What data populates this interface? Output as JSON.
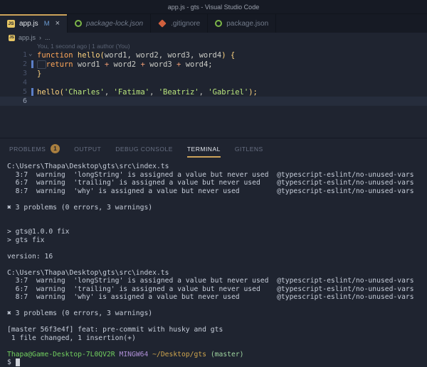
{
  "window": {
    "title": "app.js - gts - Visual Studio Code"
  },
  "colors": {
    "background": "#1f2430",
    "chrome": "#161a24",
    "accent_gold": "#cda35a",
    "keyword": "#ffa759",
    "function": "#ffd580",
    "string": "#bae67e",
    "git_modified_bar": "#5b7fc7",
    "prompt_user_green": "#72cf5f",
    "prompt_shell_magenta": "#ae8fd6",
    "prompt_path_gold": "#cea54e",
    "prompt_branch_green": "#9fd6a0"
  },
  "tabs": [
    {
      "label": "app.js",
      "icon": "js",
      "active": true,
      "modified": "M",
      "close": "×"
    },
    {
      "label": "package-lock.json",
      "icon": "npm",
      "italic": true
    },
    {
      "label": ".gitignore",
      "icon": "git"
    },
    {
      "label": "package.json",
      "icon": "npm"
    }
  ],
  "breadcrumb": {
    "file": "app.js",
    "separator": "›",
    "more": "..."
  },
  "editor": {
    "codelens": "You, 1 second ago | 1 author (You)",
    "lines": [
      {
        "num": "1",
        "fold": "⌄",
        "tokens": [
          {
            "t": "function ",
            "c": "keyword"
          },
          {
            "t": "hello",
            "c": "func"
          },
          {
            "t": "(",
            "c": "brace"
          },
          {
            "t": "word1, word2, word3, word4",
            "c": "fg"
          },
          {
            "t": ") {",
            "c": "brace"
          }
        ]
      },
      {
        "num": "2",
        "modified": true,
        "tokens": [
          {
            "t": "  ",
            "c": "fg",
            "box": true
          },
          {
            "t": "return",
            "c": "keyword"
          },
          {
            "t": " word1 ",
            "c": "fg"
          },
          {
            "t": "+",
            "c": "op"
          },
          {
            "t": " word2 ",
            "c": "fg"
          },
          {
            "t": "+",
            "c": "op"
          },
          {
            "t": " word3 ",
            "c": "fg"
          },
          {
            "t": "+",
            "c": "op"
          },
          {
            "t": " word4;",
            "c": "fg"
          }
        ]
      },
      {
        "num": "3",
        "tokens": [
          {
            "t": "}",
            "c": "brace"
          }
        ]
      },
      {
        "num": "4",
        "tokens": []
      },
      {
        "num": "5",
        "modified": true,
        "tokens": [
          {
            "t": "hello",
            "c": "func"
          },
          {
            "t": "(",
            "c": "brace"
          },
          {
            "t": "'Charles'",
            "c": "string"
          },
          {
            "t": ", ",
            "c": "fg"
          },
          {
            "t": "'Fatima'",
            "c": "string"
          },
          {
            "t": ", ",
            "c": "fg"
          },
          {
            "t": "'Beatriz'",
            "c": "string"
          },
          {
            "t": ", ",
            "c": "fg"
          },
          {
            "t": "'Gabriel'",
            "c": "string"
          },
          {
            "t": ");",
            "c": "brace"
          }
        ]
      },
      {
        "num": "6",
        "current": true,
        "tokens": []
      }
    ]
  },
  "panel": {
    "tabs": [
      {
        "label": "PROBLEMS",
        "badge": "1"
      },
      {
        "label": "OUTPUT"
      },
      {
        "label": "DEBUG CONSOLE"
      },
      {
        "label": "TERMINAL",
        "active": true
      },
      {
        "label": "GITLENS"
      }
    ]
  },
  "terminal": {
    "lines": [
      [
        {
          "t": "C:\\Users\\Thapa\\Desktop\\gts\\src\\index.ts"
        }
      ],
      [
        {
          "t": "  3:7  warning  'longString' is assigned a value but never used  @typescript-eslint/no-unused-vars"
        }
      ],
      [
        {
          "t": "  6:7  warning  'trailing' is assigned a value but never used    @typescript-eslint/no-unused-vars"
        }
      ],
      [
        {
          "t": "  8:7  warning  'why' is assigned a value but never used         @typescript-eslint/no-unused-vars"
        }
      ],
      [],
      [
        {
          "t": "✖ 3 problems (0 errors, 3 warnings)"
        }
      ],
      [],
      [],
      [
        {
          "t": "> gts@1.0.0 fix"
        }
      ],
      [
        {
          "t": "> gts fix"
        }
      ],
      [],
      [
        {
          "t": "version: 16"
        }
      ],
      [],
      [
        {
          "t": "C:\\Users\\Thapa\\Desktop\\gts\\src\\index.ts"
        }
      ],
      [
        {
          "t": "  3:7  warning  'longString' is assigned a value but never used  @typescript-eslint/no-unused-vars"
        }
      ],
      [
        {
          "t": "  6:7  warning  'trailing' is assigned a value but never used    @typescript-eslint/no-unused-vars"
        }
      ],
      [
        {
          "t": "  8:7  warning  'why' is assigned a value but never used         @typescript-eslint/no-unused-vars"
        }
      ],
      [],
      [
        {
          "t": "✖ 3 problems (0 errors, 3 warnings)"
        }
      ],
      [],
      [
        {
          "t": "[master 56f3e4f] feat: pre-commit with husky and gts"
        }
      ],
      [
        {
          "t": " 1 file changed, 1 insertion(+)"
        }
      ],
      [],
      [
        {
          "t": "Thapa@Game-Desktop-7L0QV2R",
          "c": "green"
        },
        {
          "t": " "
        },
        {
          "t": "MINGW64",
          "c": "magenta"
        },
        {
          "t": " "
        },
        {
          "t": "~/Desktop/gts",
          "c": "gold"
        },
        {
          "t": " "
        },
        {
          "t": "(master)",
          "c": "branch"
        }
      ],
      [
        {
          "t": "$ "
        },
        {
          "t": " ",
          "c": "cursor"
        }
      ]
    ]
  }
}
